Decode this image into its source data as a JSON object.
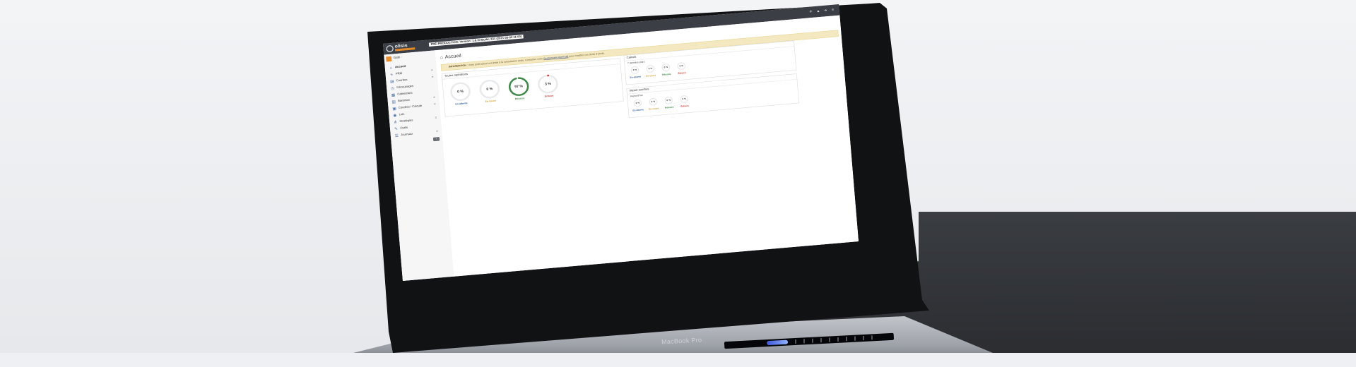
{
  "device_label": "MacBook Pro",
  "app": {
    "logo_text": "olisis",
    "version_banner": "PRÉ-PRODUCTION: Version: 1.6.10-Build: 331 (2021-03-03 11:00)",
    "top_icons": [
      "crosshair-icon",
      "bell-icon",
      "logout-icon",
      "menu-icon"
    ]
  },
  "sidebar": {
    "user": "Gabi -",
    "items": [
      {
        "label": "Accueil",
        "icon": "home-icon",
        "expandable": false,
        "active": true
      },
      {
        "label": "PRM",
        "icon": "bolt-icon",
        "expandable": true
      },
      {
        "label": "Courbes",
        "icon": "chart-icon",
        "expandable": true
      },
      {
        "label": "Découpages",
        "icon": "clock-icon",
        "expandable": false
      },
      {
        "label": "Calendriers",
        "icon": "calendar-icon",
        "expandable": false
      },
      {
        "label": "Barèmes",
        "icon": "table-icon",
        "expandable": true
      },
      {
        "label": "Courbes / Calcule",
        "icon": "calc-icon",
        "expandable": true
      },
      {
        "label": "Lois",
        "icon": "database-icon",
        "expandable": false
      },
      {
        "label": "Stratégies",
        "icon": "strategy-icon",
        "expandable": true
      },
      {
        "label": "Outils",
        "icon": "wrench-icon",
        "expandable": false
      },
      {
        "label": "Journaux",
        "icon": "list-icon",
        "expandable": true
      }
    ]
  },
  "main": {
    "title": "Accueil",
    "alert": {
      "label": "INFORMATION",
      "text": " : Votre profil actuel est limité à la consultation seule. Contactez votre ",
      "link": "Gestionnaire Applicatif",
      "suffix": " pour modifier vos droits d'accès."
    },
    "all_ops": {
      "title": "Toutes opérations",
      "gauges": [
        {
          "value": "0 %",
          "label": "En attente",
          "pct": 0,
          "color": "#2f5d9a"
        },
        {
          "value": "0 %",
          "label": "En cours",
          "pct": 0,
          "color": "#d39a2a"
        },
        {
          "value": "97 %",
          "label": "Réussis",
          "pct": 97,
          "color": "#3f8a48"
        },
        {
          "value": "3 %",
          "label": "Échecs",
          "pct": 3,
          "color": "#c0392b"
        }
      ]
    },
    "calculs": {
      "title": "Calculs",
      "subtitle": "7 derniers jours",
      "gauges": [
        {
          "value": "0 %",
          "label": "En attente",
          "color": "#2f5d9a"
        },
        {
          "value": "0 %",
          "label": "En cours",
          "color": "#d39a2a"
        },
        {
          "value": "0 %",
          "label": "Réussis",
          "color": "#3f8a48"
        },
        {
          "value": "0 %",
          "label": "Échecs",
          "color": "#c0392b"
        }
      ]
    },
    "import": {
      "title": "Import courbes",
      "subtitle": "Aujourd'hui",
      "gauges": [
        {
          "value": "0 %",
          "label": "En attente",
          "color": "#2f5d9a"
        },
        {
          "value": "0 %",
          "label": "En cours",
          "color": "#d39a2a"
        },
        {
          "value": "0 %",
          "label": "Réussis",
          "color": "#3f8a48"
        },
        {
          "value": "0 %",
          "label": "Échecs",
          "color": "#c0392b"
        }
      ]
    }
  }
}
